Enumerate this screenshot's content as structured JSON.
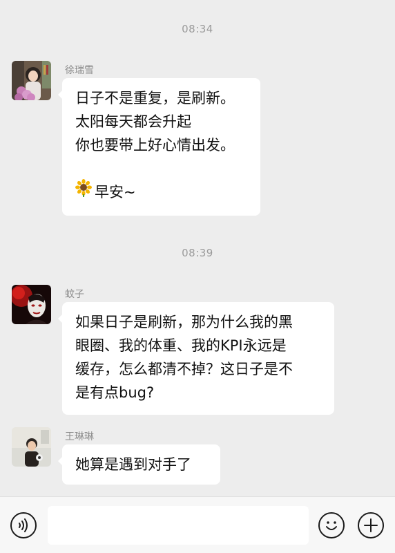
{
  "messages": {
    "t1": "08:34",
    "m1": {
      "sender": "徐瑞雪",
      "line1": "日子不是重复，是刷新。",
      "line2": "太阳每天都会升起",
      "line3": "你也要带上好心情出发。",
      "line5": "早安~"
    },
    "t2": "08:39",
    "m2": {
      "sender": "蚊子",
      "line1": "如果日子是刷新，那为什么我的黑",
      "line2": "眼圈、我的体重、我的KPI永远是",
      "line3": "缓存，怎么都清不掉？这日子是不",
      "line4": "是有点bug?"
    },
    "m3": {
      "sender": "王琳琳",
      "line1": "她算是遇到对手了"
    }
  },
  "icons": {
    "voice": "voice-icon",
    "emoji": "emoji-icon",
    "plus": "plus-icon",
    "sunflower": "sunflower-emoji"
  },
  "colors": {
    "background": "#ededed",
    "bubble": "#ffffff",
    "timestamp": "#9a9a9a",
    "sender": "#8c8c8c"
  }
}
